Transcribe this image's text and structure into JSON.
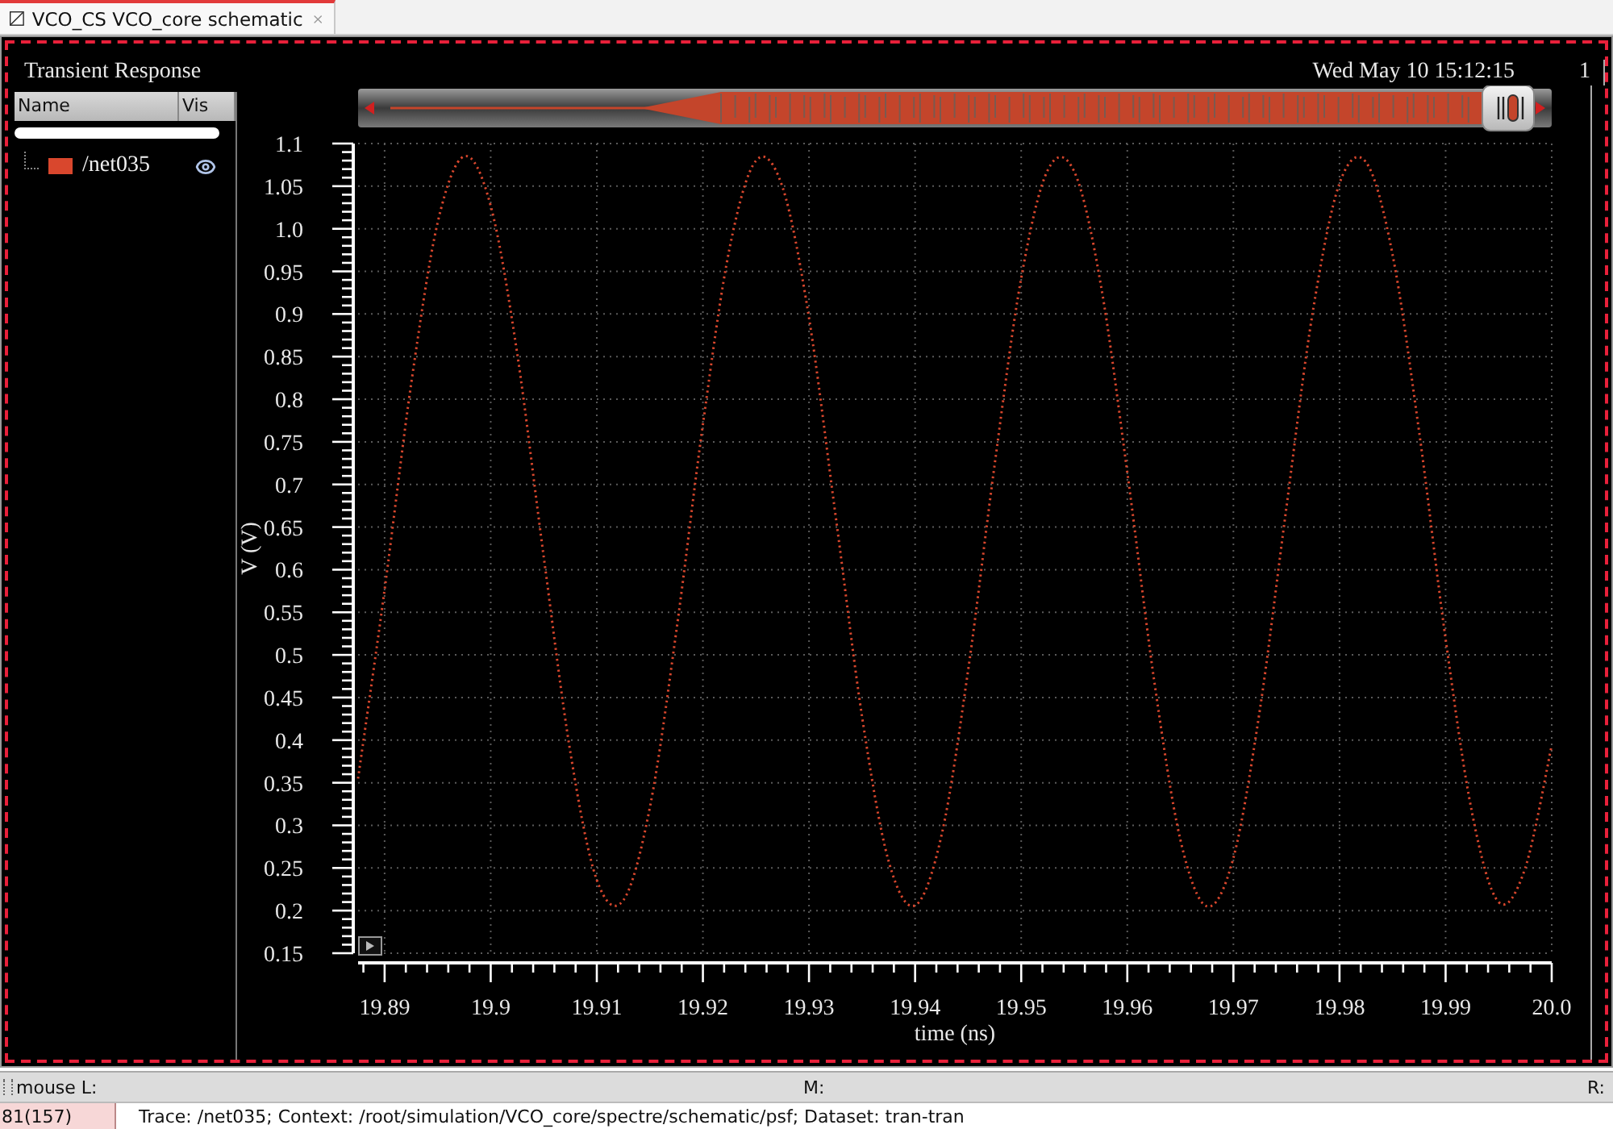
{
  "tab": {
    "title": "VCO_CS VCO_core schematic"
  },
  "graph": {
    "title": "Transient Response",
    "timestamp": "Wed May 10 15:12:15",
    "corner_text": "1"
  },
  "trace_list": {
    "columns": [
      "Name",
      "Vis"
    ],
    "traces": [
      {
        "visible": true
      }
    ]
  },
  "chart_data": {
    "type": "line",
    "grid": true,
    "xlabel": "time (ns)",
    "ylabel": "V (V)",
    "xlim": [
      19.8875,
      20.0
    ],
    "ylim": [
      0.15,
      1.1
    ],
    "xticks": [
      19.89,
      19.9,
      19.91,
      19.92,
      19.93,
      19.94,
      19.95,
      19.96,
      19.97,
      19.98,
      19.99,
      {
        "value": 20.0,
        "label": "20.0"
      }
    ],
    "yticks": [
      0.15,
      0.2,
      0.25,
      0.3,
      0.35,
      0.4,
      0.45,
      0.5,
      0.55,
      0.6,
      0.65,
      0.7,
      0.75,
      0.8,
      0.85,
      0.9,
      0.95,
      {
        "value": 1.0,
        "label": "1.0"
      },
      1.05,
      1.1
    ],
    "x": [
      19.8875,
      19.89,
      19.8925,
      19.895,
      19.8975,
      19.9,
      19.9025,
      19.905,
      19.9075,
      19.91,
      19.9125,
      19.915,
      19.9175,
      19.92,
      19.9225,
      19.925,
      19.9275,
      19.93,
      19.9325,
      19.935,
      19.9375,
      19.94,
      19.9425,
      19.945,
      19.9475,
      19.95,
      19.9525,
      19.955,
      19.9575,
      19.96,
      19.9625,
      19.965,
      19.9675,
      19.97,
      19.9725,
      19.975,
      19.9775,
      19.98,
      19.9825,
      19.985,
      19.9875,
      19.99,
      19.9925,
      19.995,
      19.9975,
      20.0
    ],
    "series": [
      {
        "name": "/net035",
        "color": "#d9472d",
        "line_style": "dotted",
        "values": [
          0.355,
          0.576,
          0.818,
          1.007,
          1.085,
          1.027,
          0.853,
          0.615,
          0.386,
          0.236,
          0.212,
          0.321,
          0.528,
          0.771,
          0.976,
          1.08,
          1.049,
          0.895,
          0.664,
          0.428,
          0.258,
          0.206,
          0.289,
          0.482,
          0.724,
          0.942,
          1.069,
          1.067,
          0.935,
          0.714,
          0.473,
          0.283,
          0.205,
          0.262,
          0.436,
          0.674,
          0.904,
          1.053,
          1.078,
          0.97,
          0.762,
          0.519,
          0.314,
          0.21,
          0.25,
          0.394
        ]
      }
    ]
  },
  "status": {
    "mouse_left": "mouse L:",
    "mouse_middle": "M:",
    "mouse_right": "R:",
    "counter": "81(157)",
    "message": "Trace: /net035; Context: /root/simulation/VCO_core/spectre/schematic/psf; Dataset: tran-tran"
  }
}
